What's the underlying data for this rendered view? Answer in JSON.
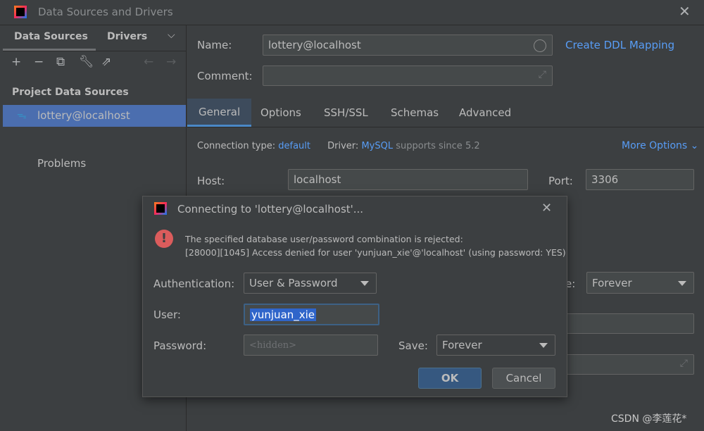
{
  "window": {
    "title": "Data Sources and Drivers"
  },
  "sidebar": {
    "tabs": [
      "Data Sources",
      "Drivers"
    ],
    "section": "Project Data Sources",
    "items": [
      {
        "label": "lottery@localhost",
        "selected": true
      }
    ],
    "problems": "Problems"
  },
  "form": {
    "name_label": "Name:",
    "name_value": "lottery@localhost",
    "ddl_link": "Create DDL Mapping",
    "comment_label": "Comment:",
    "comment_value": "",
    "tabs": [
      "General",
      "Options",
      "SSH/SSL",
      "Schemas",
      "Advanced"
    ],
    "active_tab": "General",
    "conn_type_label": "Connection type:",
    "conn_type_value": "default",
    "driver_label": "Driver:",
    "driver_value": "MySQL",
    "driver_note": "supports since 5.2",
    "more_options": "More Options",
    "host_label": "Host:",
    "host_value": "localhost",
    "port_label": "Port:",
    "port_value": "3306",
    "save_label_partial": "e:",
    "save_value": "Forever"
  },
  "dialog": {
    "title": "Connecting to 'lottery@localhost'...",
    "error_line1": "The specified database user/password combination is rejected:",
    "error_line2": "[28000][1045] Access denied for user 'yunjuan_xie'@'localhost' (using password: YES)",
    "auth_label": "Authentication:",
    "auth_value": "User & Password",
    "user_label": "User:",
    "user_value": "yunjuan_xie",
    "password_label": "Password:",
    "password_placeholder": "<hidden>",
    "save_label": "Save:",
    "save_value": "Forever",
    "ok": "OK",
    "cancel": "Cancel"
  },
  "watermark": "CSDN @李莲花*",
  "colors": {
    "accent": "#589df6",
    "selection": "#4b6eaf",
    "error": "#db5c5c",
    "primary_button": "#365880"
  }
}
